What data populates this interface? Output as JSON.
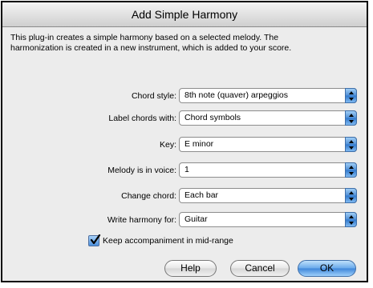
{
  "dialog": {
    "title": "Add Simple Harmony",
    "description_line1": "This plug-in creates a simple harmony based on a selected melody. The",
    "description_line2": "harmonization is created in a new instrument, which is added to your score."
  },
  "fields": [
    {
      "label": "Chord style:",
      "value": "8th note (quaver) arpeggios"
    },
    {
      "label": "Label chords with:",
      "value": "Chord symbols"
    },
    {
      "label": "Key:",
      "value": "E minor"
    },
    {
      "label": "Melody is in voice:",
      "value": "1"
    },
    {
      "label": "Change chord:",
      "value": "Each bar"
    },
    {
      "label": "Write harmony for:",
      "value": "Guitar"
    }
  ],
  "checkbox": {
    "label": "Keep accompaniment in mid-range",
    "checked": true
  },
  "buttons": {
    "help": "Help",
    "cancel": "Cancel",
    "ok": "OK"
  },
  "colors": {
    "accent": "#4f8ed6",
    "background": "#ececec"
  },
  "icons": {
    "popup": "updown-arrows-icon",
    "check": "checkmark-icon"
  }
}
